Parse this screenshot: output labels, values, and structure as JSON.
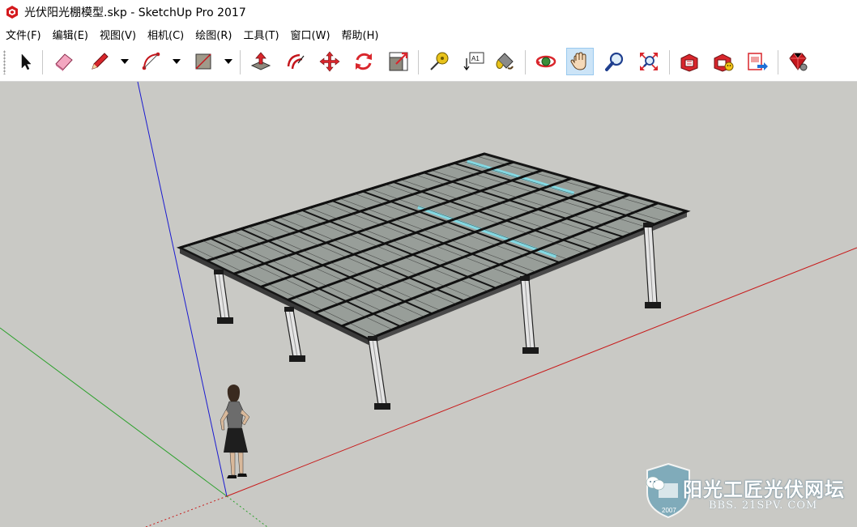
{
  "window": {
    "title": "光伏阳光棚模型.skp - SketchUp Pro 2017",
    "app_icon": "sketchup-logo-icon"
  },
  "menu": [
    {
      "label": "文件(F)"
    },
    {
      "label": "编辑(E)"
    },
    {
      "label": "视图(V)"
    },
    {
      "label": "相机(C)"
    },
    {
      "label": "绘图(R)"
    },
    {
      "label": "工具(T)"
    },
    {
      "label": "窗口(W)"
    },
    {
      "label": "帮助(H)"
    }
  ],
  "toolbar": {
    "tools": [
      {
        "name": "select-tool",
        "icon": "arrow-cursor-icon"
      },
      {
        "name": "eraser-tool",
        "icon": "eraser-icon"
      },
      {
        "name": "line-tool",
        "icon": "pencil-icon",
        "dropdown": true
      },
      {
        "name": "arc-tool",
        "icon": "arc-icon",
        "dropdown": true
      },
      {
        "name": "rectangle-tool",
        "icon": "rectangle-icon",
        "dropdown": true
      },
      {
        "name": "push-pull-tool",
        "icon": "push-pull-icon"
      },
      {
        "name": "offset-tool",
        "icon": "offset-icon"
      },
      {
        "name": "move-tool",
        "icon": "move-arrows-icon"
      },
      {
        "name": "rotate-tool",
        "icon": "rotate-icon"
      },
      {
        "name": "scale-tool",
        "icon": "scale-icon"
      },
      {
        "name": "tape-measure-tool",
        "icon": "tape-measure-icon"
      },
      {
        "name": "text-tool",
        "icon": "text-label-icon",
        "label": "A1"
      },
      {
        "name": "paint-bucket-tool",
        "icon": "paint-bucket-icon"
      },
      {
        "name": "orbit-tool",
        "icon": "orbit-icon"
      },
      {
        "name": "pan-tool",
        "icon": "hand-icon",
        "active": true
      },
      {
        "name": "zoom-tool",
        "icon": "magnifier-icon"
      },
      {
        "name": "zoom-extents-tool",
        "icon": "zoom-extents-icon"
      },
      {
        "name": "3d-warehouse",
        "icon": "warehouse-icon"
      },
      {
        "name": "extension-warehouse",
        "icon": "extension-icon"
      },
      {
        "name": "layout-send",
        "icon": "layout-send-icon"
      },
      {
        "name": "extension-manager",
        "icon": "ruby-gem-icon"
      }
    ]
  },
  "viewport": {
    "background_color": "#c9c9c5",
    "axis_colors": {
      "red": "#c00000",
      "green": "#00a000",
      "blue": "#0000c0"
    }
  },
  "watermark": {
    "main_text": "阳光工匠光伏网坛",
    "sub_text": "BBS. 21SPV. COM",
    "badge_year": "2007"
  }
}
